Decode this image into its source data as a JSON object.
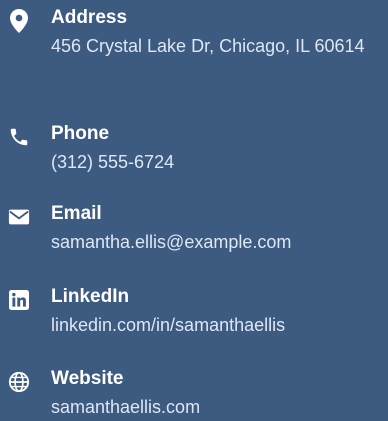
{
  "contact": {
    "address": {
      "icon": "map-pin-icon",
      "label": "Address",
      "value": "456 Crystal Lake Dr, Chicago, IL 60614"
    },
    "phone": {
      "icon": "phone-icon",
      "label": "Phone",
      "value": "(312) 555-6724"
    },
    "email": {
      "icon": "envelope-icon",
      "label": "Email",
      "value": "samantha.ellis@example.com"
    },
    "linkedin": {
      "icon": "linkedin-icon",
      "label": "LinkedIn",
      "value": "linkedin.com/in/samanthaellis"
    },
    "website": {
      "icon": "globe-icon",
      "label": "Website",
      "value": "samanthaellis.com"
    }
  },
  "colors": {
    "background": "#3d5a80",
    "label_text": "#ffffff",
    "value_text": "#dde7f5"
  }
}
